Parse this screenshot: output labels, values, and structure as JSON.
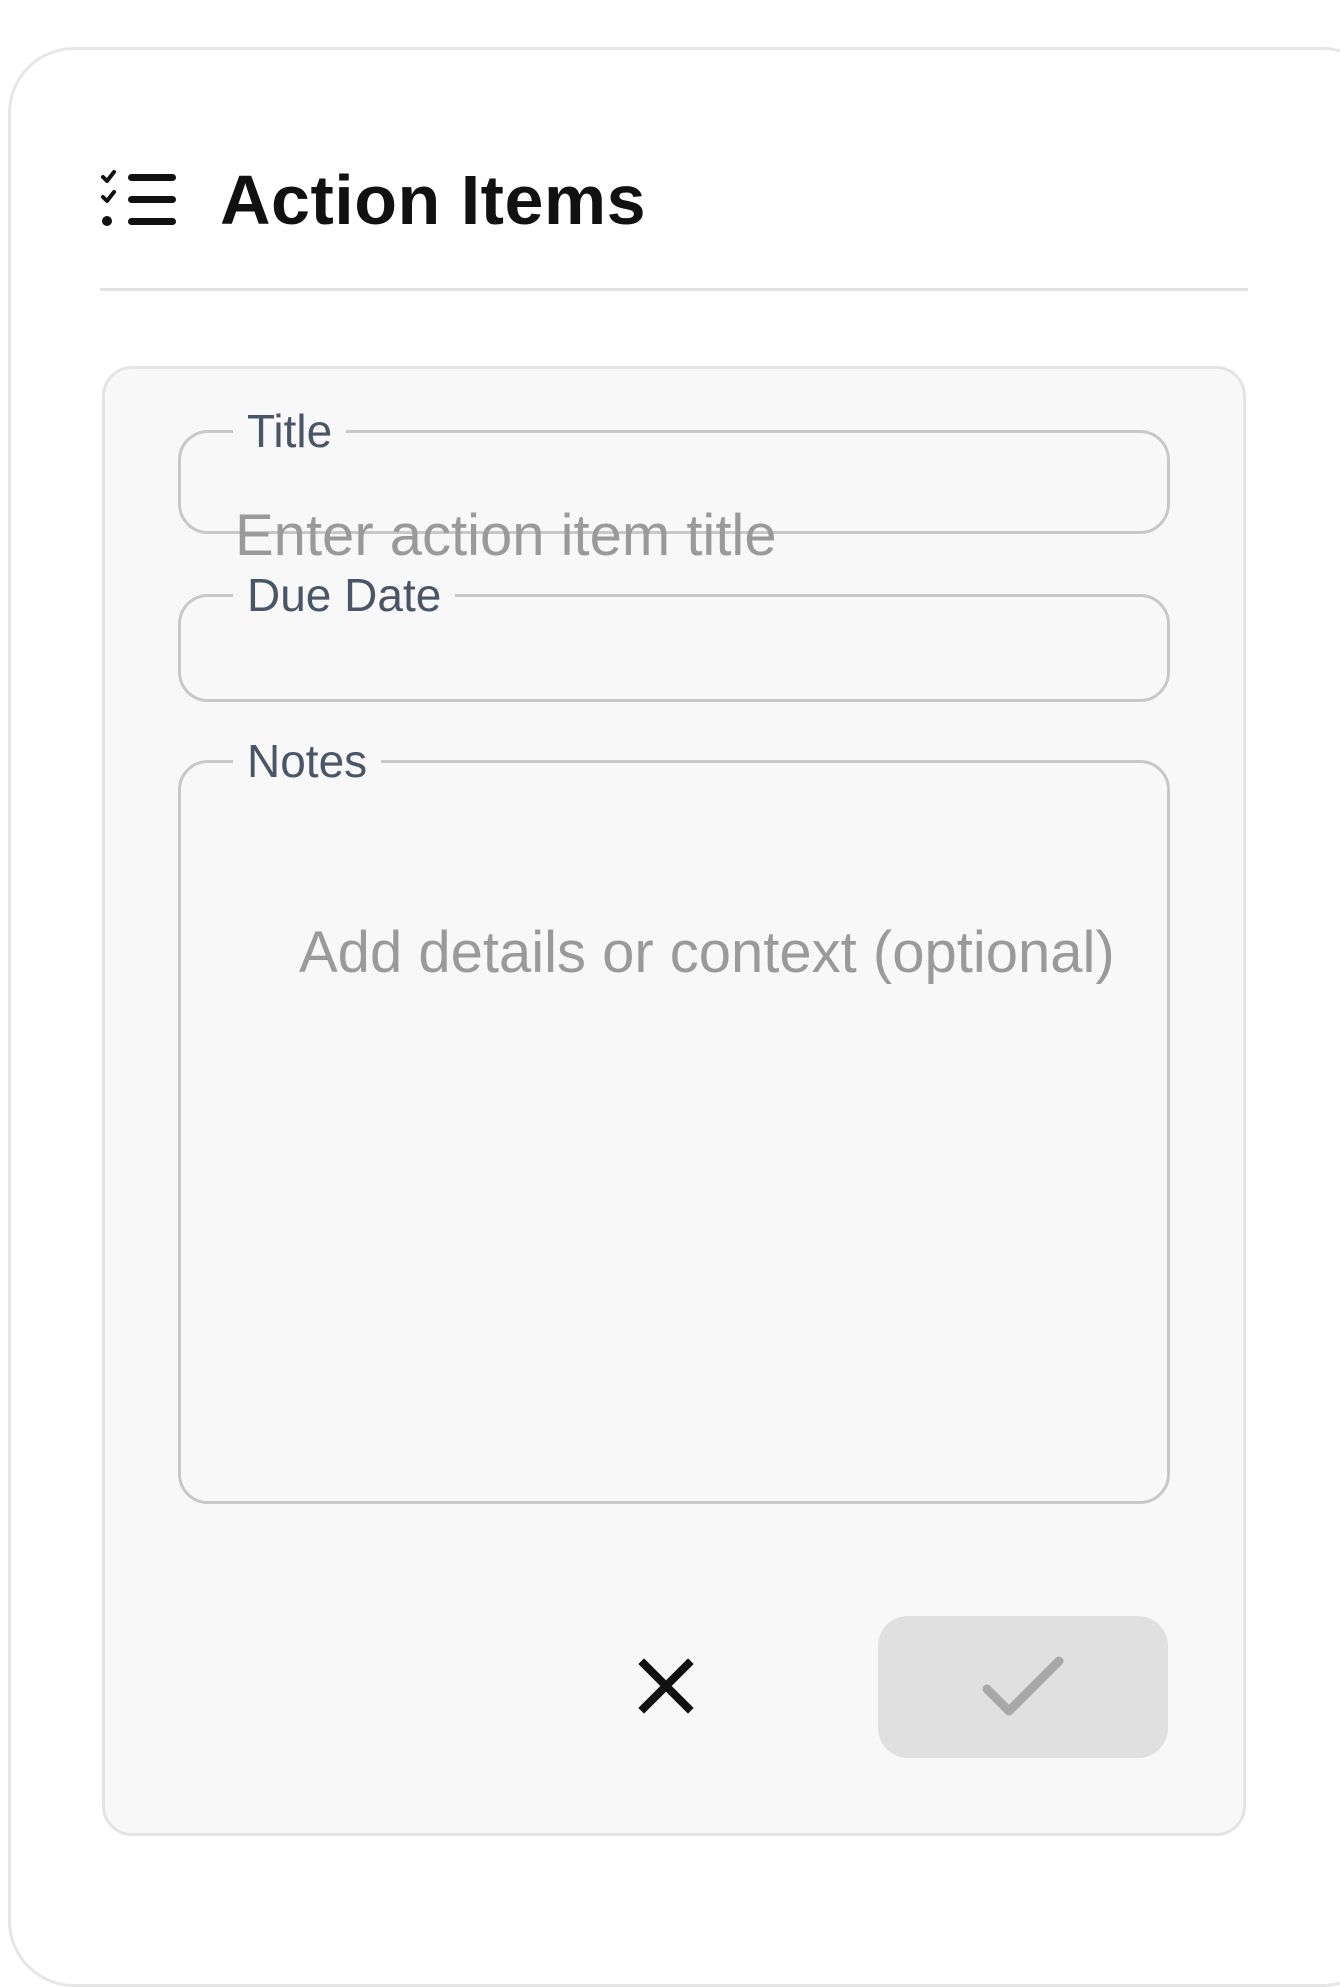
{
  "header": {
    "icon": "checklist-icon",
    "title": "Action Items"
  },
  "form": {
    "title_field": {
      "label": "Title",
      "value": "",
      "placeholder": "Enter action item title"
    },
    "due_date_field": {
      "label": "Due Date",
      "value": ""
    },
    "notes_field": {
      "label": "Notes",
      "value": "",
      "placeholder": "Add details or context (optional)"
    },
    "actions": {
      "cancel_icon": "close-icon",
      "confirm_icon": "check-icon",
      "confirm_disabled": true
    }
  },
  "colors": {
    "card_border": "#e6e6e6",
    "panel_background": "#f8f8f8",
    "field_border": "#c8c8c8",
    "label_text": "#4a5568",
    "placeholder_text": "#9a9a9a",
    "confirm_background": "#e0e0e0",
    "confirm_icon": "#a8a8a8"
  }
}
